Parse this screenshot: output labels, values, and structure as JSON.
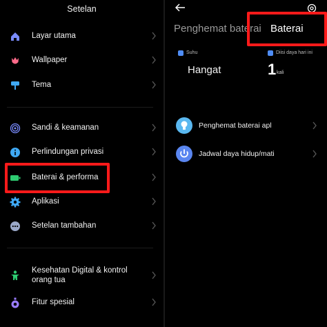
{
  "left_panel": {
    "title": "Setelan",
    "items": [
      {
        "label": "Layar utama",
        "icon": "home-icon"
      },
      {
        "label": "Wallpaper",
        "icon": "tulip-icon"
      },
      {
        "label": "Tema",
        "icon": "paint-roller-icon"
      },
      {
        "label": "Sandi & keamanan",
        "icon": "fingerprint-icon"
      },
      {
        "label": "Perlindungan privasi",
        "icon": "shield-info-icon"
      },
      {
        "label": "Baterai & performa",
        "icon": "battery-icon"
      },
      {
        "label": "Aplikasi",
        "icon": "gear-icon"
      },
      {
        "label": "Setelan tambahan",
        "icon": "more-dots-icon"
      },
      {
        "label": "Kesehatan Digital & kontrol orang tua",
        "icon": "wellbeing-icon"
      },
      {
        "label": "Fitur spesial",
        "icon": "special-features-icon"
      }
    ]
  },
  "right_panel": {
    "tabs": [
      "Penghemat baterai",
      "Baterai"
    ],
    "stats": {
      "temp_label": "Suhu",
      "temp_value": "Hangat",
      "charge_label": "Diisi daya hari ini",
      "charge_count": "1",
      "charge_unit": "kali"
    },
    "options": [
      {
        "label": "Penghemat baterai apl",
        "icon": "bulb-icon"
      },
      {
        "label": "Jadwal daya hidup/mati",
        "icon": "power-icon"
      }
    ]
  },
  "colors": {
    "highlight": "#ff1a1a",
    "battery_green": "#2ecc71",
    "accent_blue": "#4f8df5"
  }
}
